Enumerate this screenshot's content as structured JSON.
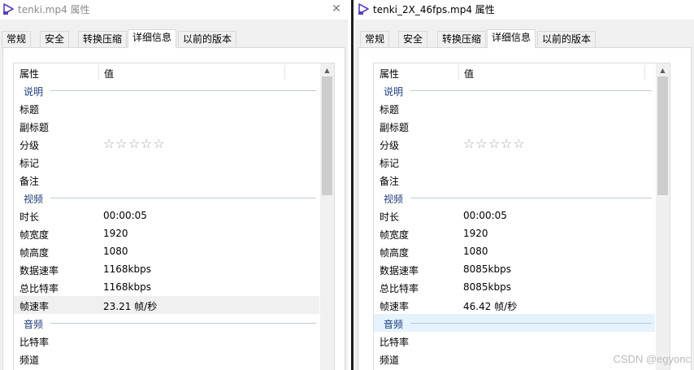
{
  "left": {
    "title": "tenki.mp4 属性",
    "tabs": [
      "常规",
      "安全",
      "转换压缩",
      "详细信息",
      "以前的版本"
    ],
    "active_tab": "详细信息",
    "headers": {
      "property": "属性",
      "value": "值"
    },
    "groups": {
      "description": "说明",
      "video": "视频",
      "audio": "音频"
    },
    "desc_rows": [
      "标题",
      "副标题",
      "分级",
      "标记",
      "备注"
    ],
    "rating_stars": "☆☆☆☆☆",
    "video_rows": [
      {
        "name": "时长",
        "value": "00:00:05"
      },
      {
        "name": "帧宽度",
        "value": "1920"
      },
      {
        "name": "帧高度",
        "value": "1080"
      },
      {
        "name": "数据速率",
        "value": "1168kbps"
      },
      {
        "name": "总比特率",
        "value": "1168kbps"
      },
      {
        "name": "帧速率",
        "value": "23.21 帧/秒"
      }
    ],
    "audio_rows": [
      "比特率",
      "频道"
    ]
  },
  "right": {
    "title": "tenki_2X_46fps.mp4 属性",
    "tabs": [
      "常规",
      "安全",
      "转换压缩",
      "详细信息",
      "以前的版本"
    ],
    "active_tab": "详细信息",
    "headers": {
      "property": "属性",
      "value": "值"
    },
    "groups": {
      "description": "说明",
      "video": "视频",
      "audio": "音频"
    },
    "desc_rows": [
      "标题",
      "副标题",
      "分级",
      "标记",
      "备注"
    ],
    "rating_stars": "☆☆☆☆☆",
    "video_rows": [
      {
        "name": "时长",
        "value": "00:00:05"
      },
      {
        "name": "帧宽度",
        "value": "1920"
      },
      {
        "name": "帧高度",
        "value": "1080"
      },
      {
        "name": "数据速率",
        "value": "8085kbps"
      },
      {
        "name": "总比特率",
        "value": "8085kbps"
      },
      {
        "name": "帧速率",
        "value": "46.42 帧/秒"
      }
    ],
    "audio_rows": [
      "比特率",
      "频道"
    ]
  },
  "watermark": "CSDN @egyonc",
  "icons": {
    "title_icon": "video-file-icon",
    "close": "close-icon"
  },
  "colors": {
    "group_text": "#1e3d7b",
    "selection": "#e5f3ff"
  }
}
